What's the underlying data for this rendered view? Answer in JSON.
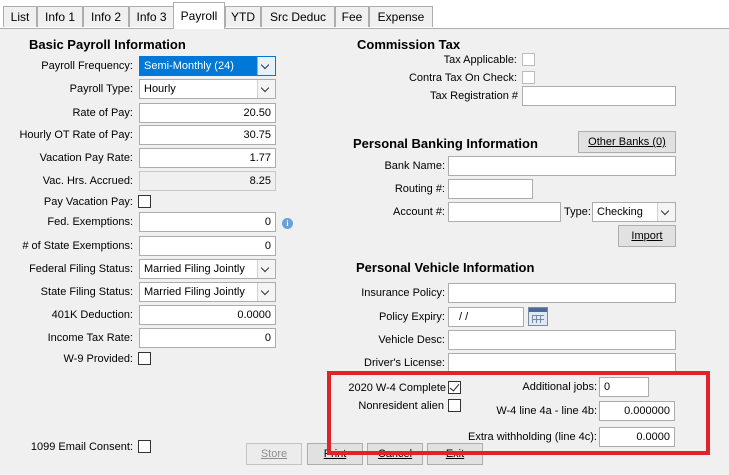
{
  "tabs": [
    "List",
    "Info 1",
    "Info 2",
    "Info 3",
    "Payroll",
    "YTD",
    "Src Deduc",
    "Fee",
    "Expense"
  ],
  "active_tab": "Payroll",
  "basic": {
    "title": "Basic Payroll Information",
    "payroll_frequency_label": "Payroll Frequency:",
    "payroll_frequency_value": "Semi-Monthly (24)",
    "payroll_type_label": "Payroll Type:",
    "payroll_type_value": "Hourly",
    "rate_of_pay_label": "Rate of Pay:",
    "rate_of_pay_value": "20.50",
    "hourly_ot_label": "Hourly OT Rate of Pay:",
    "hourly_ot_value": "30.75",
    "vacation_rate_label": "Vacation Pay Rate:",
    "vacation_rate_value": "1.77",
    "vac_hrs_label": "Vac. Hrs. Accrued:",
    "vac_hrs_value": "8.25",
    "pay_vacation_label": "Pay Vacation Pay:",
    "fed_exemptions_label": "Fed. Exemptions:",
    "fed_exemptions_value": "0",
    "state_exemptions_label": "# of State Exemptions:",
    "state_exemptions_value": "0",
    "federal_filing_label": "Federal Filing Status:",
    "federal_filing_value": "Married Filing Jointly",
    "state_filing_label": "State Filing Status:",
    "state_filing_value": "Married Filing Jointly",
    "k401_label": "401K Deduction:",
    "k401_value": "0.0000",
    "income_tax_label": "Income Tax Rate:",
    "income_tax_value": "0",
    "w9_label": "W-9 Provided:",
    "email_consent_label": "1099 Email Consent:"
  },
  "commission": {
    "title": "Commission Tax",
    "tax_applicable_label": "Tax Applicable:",
    "contra_tax_label": "Contra Tax On Check:",
    "tax_reg_label": "Tax Registration #",
    "tax_reg_value": ""
  },
  "banking": {
    "title": "Personal Banking Information",
    "other_banks_label": "Other Banks (0)",
    "bank_name_label": "Bank Name:",
    "routing_label": "Routing #:",
    "account_label": "Account #:",
    "type_label": "Type:",
    "type_value": "Checking",
    "import_label": "Import"
  },
  "vehicle": {
    "title": "Personal Vehicle Information",
    "insurance_label": "Insurance Policy:",
    "expiry_label": "Policy Expiry:",
    "expiry_value": "/ /",
    "vehicle_desc_label": "Vehicle Desc:",
    "drivers_license_label": "Driver's License:"
  },
  "w4": {
    "complete_label": "2020 W-4 Complete",
    "nonresident_label": "Nonresident alien",
    "additional_jobs_label": "Additional jobs:",
    "additional_jobs_value": "0",
    "line4a4b_label": "W-4 line 4a - line 4b:",
    "line4a4b_value": "0.000000",
    "extra_withholding_label": "Extra withholding (line 4c):",
    "extra_withholding_value": "0.0000"
  },
  "buttons": {
    "store": "Store",
    "print": "Print",
    "cancel": "Cancel",
    "exit": "Exit"
  },
  "highlight_color": "#e0222a"
}
